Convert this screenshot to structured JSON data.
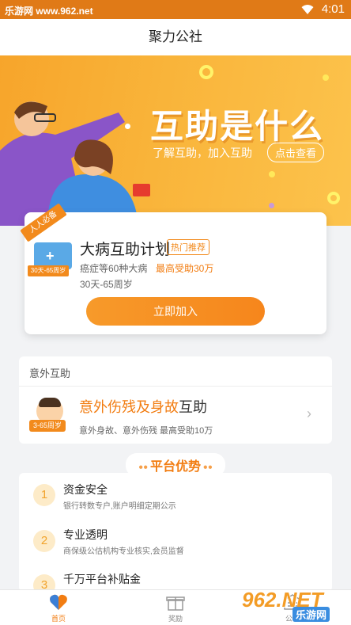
{
  "status_bar": {
    "site": "乐游网 www.962.net",
    "time": "4:01"
  },
  "title": "聚力公社",
  "banner": {
    "title": "互助是什么",
    "subtitle": "了解互助，加入互助",
    "button": "点击查看"
  },
  "plan": {
    "ribbon": "人人必备",
    "icon_tag": "30天-65周岁",
    "name": "大病互助计划",
    "tag": "热门推荐",
    "desc": "癌症等60种大病",
    "highlight": "最高受助30万",
    "age": "30天-65周岁",
    "join": "立即加入"
  },
  "accident": {
    "header": "意外互助",
    "age_tag": "3-65周岁",
    "title_highlight": "意外伤残及身故",
    "title_rest": "互助",
    "desc": "意外身故、意外伤残  最高受助10万"
  },
  "advantages": {
    "heading": "平台优势",
    "items": [
      {
        "num": "1",
        "title": "资金安全",
        "desc": "银行转数专户,账户明细定期公示"
      },
      {
        "num": "2",
        "title": "专业透明",
        "desc": "商保级公估机构专业核实,会员监督"
      },
      {
        "num": "3",
        "title": "千万平台补贴金",
        "desc": ""
      }
    ]
  },
  "tabs": [
    {
      "label": "首页",
      "icon": "heart-icon",
      "active": true
    },
    {
      "label": "奖励",
      "icon": "gift-icon",
      "active": false
    },
    {
      "label": "公示",
      "icon": "notice-icon",
      "active": false
    }
  ],
  "watermark": {
    "logo": "962.NET",
    "text": "乐游网"
  },
  "colors": {
    "accent": "#f27d12",
    "banner": "#f9b43a",
    "status_bar": "#e07a17"
  }
}
